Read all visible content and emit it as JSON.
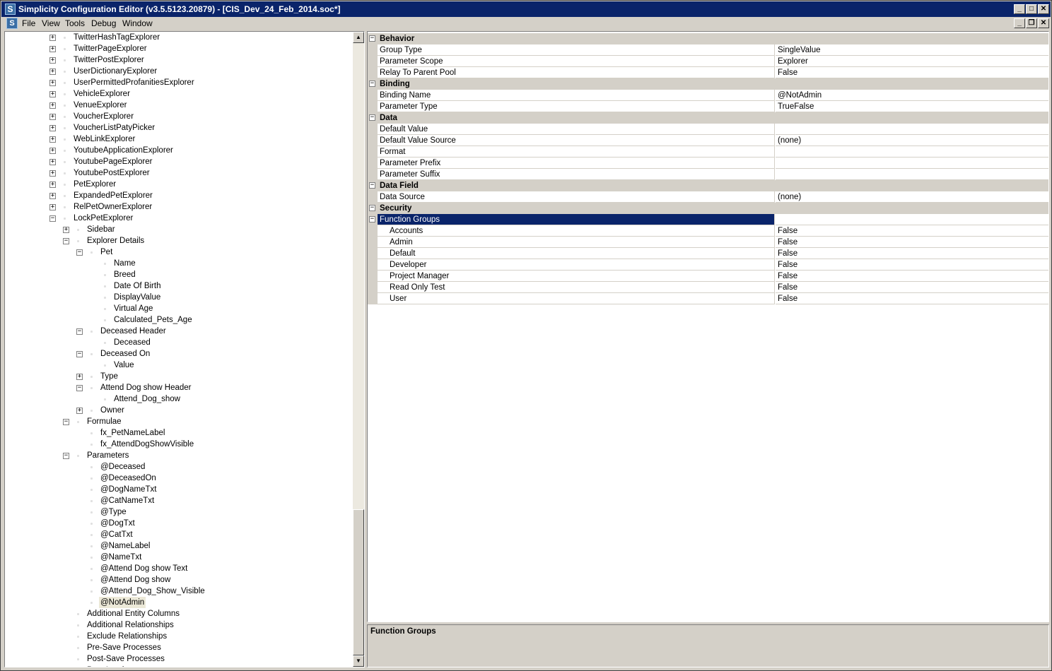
{
  "window": {
    "title": "Simplicity Configuration Editor (v3.5.5123.20879) - [CIS_Dev_24_Feb_2014.soc*]",
    "app_icon_letter": "S"
  },
  "menu": {
    "items": [
      "File",
      "View",
      "Tools",
      "Debug",
      "Window"
    ]
  },
  "tree": {
    "rows": [
      {
        "label": "TwitterHashTagExplorer",
        "level": 0,
        "toggle": "+"
      },
      {
        "label": "TwitterPageExplorer",
        "level": 0,
        "toggle": "+"
      },
      {
        "label": "TwitterPostExplorer",
        "level": 0,
        "toggle": "+"
      },
      {
        "label": "UserDictionaryExplorer",
        "level": 0,
        "toggle": "+"
      },
      {
        "label": "UserPermittedProfanitiesExplorer",
        "level": 0,
        "toggle": "+"
      },
      {
        "label": "VehicleExplorer",
        "level": 0,
        "toggle": "+"
      },
      {
        "label": "VenueExplorer",
        "level": 0,
        "toggle": "+"
      },
      {
        "label": "VoucherExplorer",
        "level": 0,
        "toggle": "+"
      },
      {
        "label": "VoucherListPatyPicker",
        "level": 0,
        "toggle": "+"
      },
      {
        "label": "WebLinkExplorer",
        "level": 0,
        "toggle": "+"
      },
      {
        "label": "YoutubeApplicationExplorer",
        "level": 0,
        "toggle": "+"
      },
      {
        "label": "YoutubePageExplorer",
        "level": 0,
        "toggle": "+"
      },
      {
        "label": "YoutubePostExplorer",
        "level": 0,
        "toggle": "+"
      },
      {
        "label": "PetExplorer",
        "level": 0,
        "toggle": "+"
      },
      {
        "label": "ExpandedPetExplorer",
        "level": 0,
        "toggle": "+"
      },
      {
        "label": "RelPetOwnerExplorer",
        "level": 0,
        "toggle": "+"
      },
      {
        "label": "LockPetExplorer",
        "level": 0,
        "toggle": "-"
      },
      {
        "label": "Sidebar",
        "level": 1,
        "toggle": "+"
      },
      {
        "label": "Explorer Details",
        "level": 1,
        "toggle": "-"
      },
      {
        "label": "Pet",
        "level": 2,
        "toggle": "-"
      },
      {
        "label": "Name",
        "level": 3,
        "toggle": ""
      },
      {
        "label": "Breed",
        "level": 3,
        "toggle": ""
      },
      {
        "label": "Date Of Birth",
        "level": 3,
        "toggle": ""
      },
      {
        "label": "DisplayValue",
        "level": 3,
        "toggle": ""
      },
      {
        "label": "Virtual Age",
        "level": 3,
        "toggle": ""
      },
      {
        "label": "Calculated_Pets_Age",
        "level": 3,
        "toggle": ""
      },
      {
        "label": "Deceased Header",
        "level": 2,
        "toggle": "-"
      },
      {
        "label": "Deceased",
        "level": 3,
        "toggle": ""
      },
      {
        "label": "Deceased On",
        "level": 2,
        "toggle": "-"
      },
      {
        "label": "Value",
        "level": 3,
        "toggle": ""
      },
      {
        "label": "Type",
        "level": 2,
        "toggle": "+"
      },
      {
        "label": "Attend Dog show Header",
        "level": 2,
        "toggle": "-"
      },
      {
        "label": "Attend_Dog_show",
        "level": 3,
        "toggle": ""
      },
      {
        "label": "Owner",
        "level": 2,
        "toggle": "+"
      },
      {
        "label": "Formulae",
        "level": 1,
        "toggle": "-"
      },
      {
        "label": "fx_PetNameLabel",
        "level": 2,
        "toggle": ""
      },
      {
        "label": "fx_AttendDogShowVisible",
        "level": 2,
        "toggle": ""
      },
      {
        "label": "Parameters",
        "level": 1,
        "toggle": "-"
      },
      {
        "label": "@Deceased",
        "level": 2,
        "toggle": ""
      },
      {
        "label": "@DeceasedOn",
        "level": 2,
        "toggle": ""
      },
      {
        "label": "@DogNameTxt",
        "level": 2,
        "toggle": ""
      },
      {
        "label": "@CatNameTxt",
        "level": 2,
        "toggle": ""
      },
      {
        "label": "@Type",
        "level": 2,
        "toggle": ""
      },
      {
        "label": "@DogTxt",
        "level": 2,
        "toggle": ""
      },
      {
        "label": "@CatTxt",
        "level": 2,
        "toggle": ""
      },
      {
        "label": "@NameLabel",
        "level": 2,
        "toggle": ""
      },
      {
        "label": "@NameTxt",
        "level": 2,
        "toggle": ""
      },
      {
        "label": "@Attend Dog show Text",
        "level": 2,
        "toggle": ""
      },
      {
        "label": "@Attend Dog show",
        "level": 2,
        "toggle": ""
      },
      {
        "label": "@Attend_Dog_Show_Visible",
        "level": 2,
        "toggle": ""
      },
      {
        "label": "@NotAdmin",
        "level": 2,
        "toggle": "",
        "selected": true
      },
      {
        "label": "Additional Entity Columns",
        "level": 1,
        "toggle": ""
      },
      {
        "label": "Additional Relationships",
        "level": 1,
        "toggle": ""
      },
      {
        "label": "Exclude Relationships",
        "level": 1,
        "toggle": ""
      },
      {
        "label": "Pre-Save Processes",
        "level": 1,
        "toggle": ""
      },
      {
        "label": "Post-Save Processes",
        "level": 1,
        "toggle": ""
      },
      {
        "label": "Post-Load ...",
        "level": 1,
        "toggle": ""
      }
    ]
  },
  "properties": {
    "rows": [
      {
        "kind": "category",
        "name": "Behavior"
      },
      {
        "kind": "prop",
        "name": "Group Type",
        "value": "SingleValue"
      },
      {
        "kind": "prop",
        "name": "Parameter Scope",
        "value": "Explorer"
      },
      {
        "kind": "prop",
        "name": "Relay To Parent Pool",
        "value": "False"
      },
      {
        "kind": "category",
        "name": "Binding"
      },
      {
        "kind": "prop",
        "name": "Binding Name",
        "value": "@NotAdmin"
      },
      {
        "kind": "prop",
        "name": "Parameter Type",
        "value": "TrueFalse"
      },
      {
        "kind": "category",
        "name": "Data"
      },
      {
        "kind": "prop",
        "name": "Default Value",
        "value": ""
      },
      {
        "kind": "prop",
        "name": "Default Value Source",
        "value": "(none)"
      },
      {
        "kind": "prop",
        "name": "Format",
        "value": ""
      },
      {
        "kind": "prop",
        "name": "Parameter Prefix",
        "value": ""
      },
      {
        "kind": "prop",
        "name": "Parameter Suffix",
        "value": ""
      },
      {
        "kind": "category",
        "name": "Data Field"
      },
      {
        "kind": "prop",
        "name": "Data Source",
        "value": "(none)"
      },
      {
        "kind": "category",
        "name": "Security"
      },
      {
        "kind": "group",
        "name": "Function Groups",
        "value": "",
        "selected": true
      },
      {
        "kind": "sub",
        "name": "Accounts",
        "value": "False"
      },
      {
        "kind": "sub",
        "name": "Admin",
        "value": "False"
      },
      {
        "kind": "sub",
        "name": "Default",
        "value": "False"
      },
      {
        "kind": "sub",
        "name": "Developer",
        "value": "False"
      },
      {
        "kind": "sub",
        "name": "Project Manager",
        "value": "False"
      },
      {
        "kind": "sub",
        "name": "Read Only Test",
        "value": "False"
      },
      {
        "kind": "sub",
        "name": "User",
        "value": "False"
      }
    ]
  },
  "description": {
    "title": "Function Groups"
  },
  "colors": {
    "title_bar": "#0a246a",
    "selection": "#0a246a",
    "face": "#d4d0c8"
  }
}
